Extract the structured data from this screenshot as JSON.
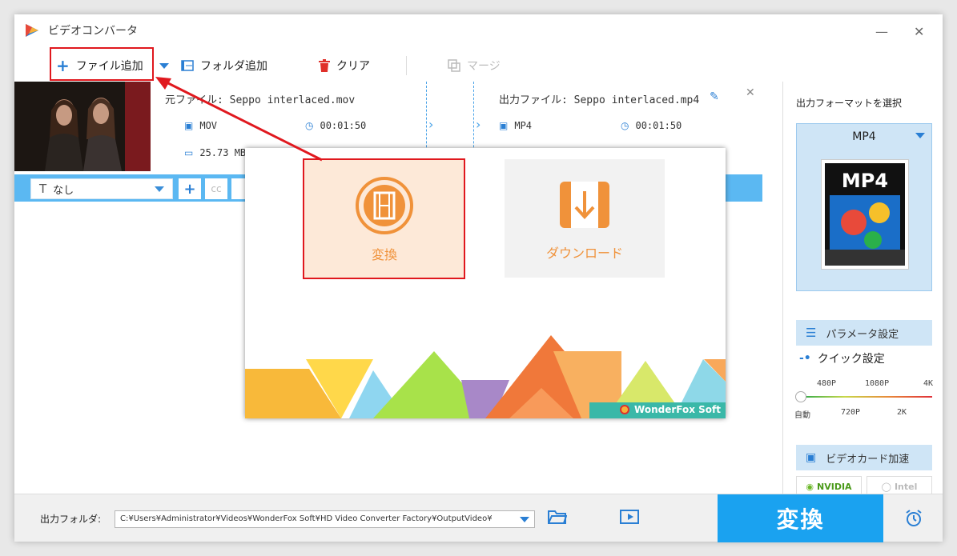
{
  "window": {
    "title": "ビデオコンバータ"
  },
  "toolbar": {
    "add_file": "ファイル追加",
    "add_folder": "フォルダ追加",
    "clear": "クリア",
    "merge": "マージ"
  },
  "file": {
    "source_name": "元ファイル: Seppo interlaced.mov",
    "output_name": "出力ファイル: Seppo interlaced.mp4",
    "source_format": "MOV",
    "source_duration": "00:01:50",
    "source_size": "25.73 MB",
    "output_format": "MP4",
    "output_duration": "00:01:50"
  },
  "edit_bar": {
    "subtitle": "なし"
  },
  "modal": {
    "convert_label": "変換",
    "download_label": "ダウンロード",
    "brand": "WonderFox Soft"
  },
  "right_panel": {
    "title": "出力フォーマットを選択",
    "format": "MP4",
    "format_art_text": "MP4",
    "param_button": "パラメータ設定",
    "quick_title": "クイック設定",
    "res_top": [
      "480P",
      "1080P",
      "4K"
    ],
    "res_bottom": [
      "自動",
      "720P",
      "2K"
    ],
    "gpu_button": "ビデオカード加速",
    "nvidia": "NVIDIA",
    "intel": "Intel"
  },
  "bottom": {
    "output_label": "出力フォルダ:",
    "output_path": "C:¥Users¥Administrator¥Videos¥WonderFox Soft¥HD Video Converter Factory¥OutputVideo¥",
    "convert": "変換"
  },
  "colors": {
    "accent": "#1aa2f0",
    "highlight": "#e0181e",
    "orange": "#f0923a"
  }
}
